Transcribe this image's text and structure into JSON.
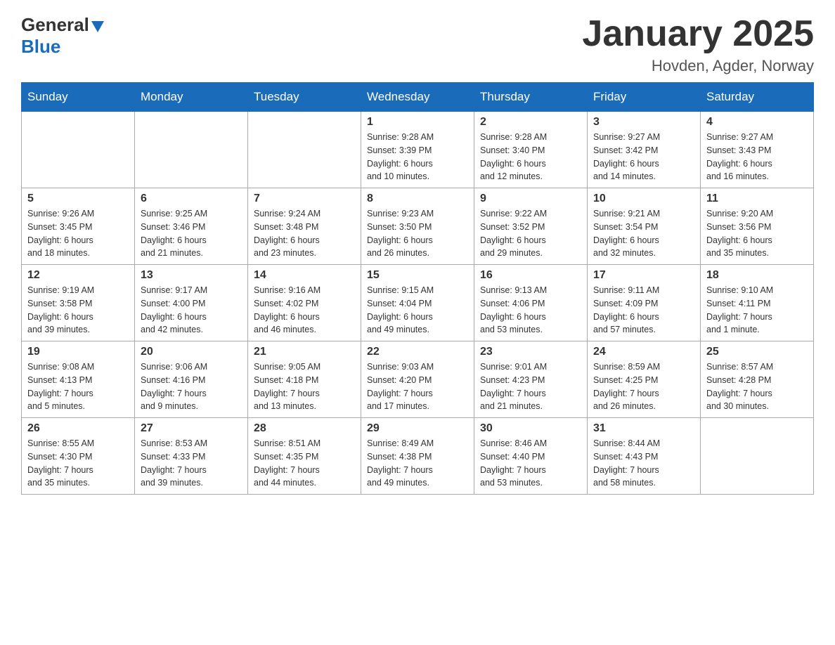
{
  "header": {
    "logo_general": "General",
    "logo_blue": "Blue",
    "month_title": "January 2025",
    "location": "Hovden, Agder, Norway"
  },
  "weekdays": [
    "Sunday",
    "Monday",
    "Tuesday",
    "Wednesday",
    "Thursday",
    "Friday",
    "Saturday"
  ],
  "weeks": [
    [
      {
        "day": "",
        "info": ""
      },
      {
        "day": "",
        "info": ""
      },
      {
        "day": "",
        "info": ""
      },
      {
        "day": "1",
        "info": "Sunrise: 9:28 AM\nSunset: 3:39 PM\nDaylight: 6 hours\nand 10 minutes."
      },
      {
        "day": "2",
        "info": "Sunrise: 9:28 AM\nSunset: 3:40 PM\nDaylight: 6 hours\nand 12 minutes."
      },
      {
        "day": "3",
        "info": "Sunrise: 9:27 AM\nSunset: 3:42 PM\nDaylight: 6 hours\nand 14 minutes."
      },
      {
        "day": "4",
        "info": "Sunrise: 9:27 AM\nSunset: 3:43 PM\nDaylight: 6 hours\nand 16 minutes."
      }
    ],
    [
      {
        "day": "5",
        "info": "Sunrise: 9:26 AM\nSunset: 3:45 PM\nDaylight: 6 hours\nand 18 minutes."
      },
      {
        "day": "6",
        "info": "Sunrise: 9:25 AM\nSunset: 3:46 PM\nDaylight: 6 hours\nand 21 minutes."
      },
      {
        "day": "7",
        "info": "Sunrise: 9:24 AM\nSunset: 3:48 PM\nDaylight: 6 hours\nand 23 minutes."
      },
      {
        "day": "8",
        "info": "Sunrise: 9:23 AM\nSunset: 3:50 PM\nDaylight: 6 hours\nand 26 minutes."
      },
      {
        "day": "9",
        "info": "Sunrise: 9:22 AM\nSunset: 3:52 PM\nDaylight: 6 hours\nand 29 minutes."
      },
      {
        "day": "10",
        "info": "Sunrise: 9:21 AM\nSunset: 3:54 PM\nDaylight: 6 hours\nand 32 minutes."
      },
      {
        "day": "11",
        "info": "Sunrise: 9:20 AM\nSunset: 3:56 PM\nDaylight: 6 hours\nand 35 minutes."
      }
    ],
    [
      {
        "day": "12",
        "info": "Sunrise: 9:19 AM\nSunset: 3:58 PM\nDaylight: 6 hours\nand 39 minutes."
      },
      {
        "day": "13",
        "info": "Sunrise: 9:17 AM\nSunset: 4:00 PM\nDaylight: 6 hours\nand 42 minutes."
      },
      {
        "day": "14",
        "info": "Sunrise: 9:16 AM\nSunset: 4:02 PM\nDaylight: 6 hours\nand 46 minutes."
      },
      {
        "day": "15",
        "info": "Sunrise: 9:15 AM\nSunset: 4:04 PM\nDaylight: 6 hours\nand 49 minutes."
      },
      {
        "day": "16",
        "info": "Sunrise: 9:13 AM\nSunset: 4:06 PM\nDaylight: 6 hours\nand 53 minutes."
      },
      {
        "day": "17",
        "info": "Sunrise: 9:11 AM\nSunset: 4:09 PM\nDaylight: 6 hours\nand 57 minutes."
      },
      {
        "day": "18",
        "info": "Sunrise: 9:10 AM\nSunset: 4:11 PM\nDaylight: 7 hours\nand 1 minute."
      }
    ],
    [
      {
        "day": "19",
        "info": "Sunrise: 9:08 AM\nSunset: 4:13 PM\nDaylight: 7 hours\nand 5 minutes."
      },
      {
        "day": "20",
        "info": "Sunrise: 9:06 AM\nSunset: 4:16 PM\nDaylight: 7 hours\nand 9 minutes."
      },
      {
        "day": "21",
        "info": "Sunrise: 9:05 AM\nSunset: 4:18 PM\nDaylight: 7 hours\nand 13 minutes."
      },
      {
        "day": "22",
        "info": "Sunrise: 9:03 AM\nSunset: 4:20 PM\nDaylight: 7 hours\nand 17 minutes."
      },
      {
        "day": "23",
        "info": "Sunrise: 9:01 AM\nSunset: 4:23 PM\nDaylight: 7 hours\nand 21 minutes."
      },
      {
        "day": "24",
        "info": "Sunrise: 8:59 AM\nSunset: 4:25 PM\nDaylight: 7 hours\nand 26 minutes."
      },
      {
        "day": "25",
        "info": "Sunrise: 8:57 AM\nSunset: 4:28 PM\nDaylight: 7 hours\nand 30 minutes."
      }
    ],
    [
      {
        "day": "26",
        "info": "Sunrise: 8:55 AM\nSunset: 4:30 PM\nDaylight: 7 hours\nand 35 minutes."
      },
      {
        "day": "27",
        "info": "Sunrise: 8:53 AM\nSunset: 4:33 PM\nDaylight: 7 hours\nand 39 minutes."
      },
      {
        "day": "28",
        "info": "Sunrise: 8:51 AM\nSunset: 4:35 PM\nDaylight: 7 hours\nand 44 minutes."
      },
      {
        "day": "29",
        "info": "Sunrise: 8:49 AM\nSunset: 4:38 PM\nDaylight: 7 hours\nand 49 minutes."
      },
      {
        "day": "30",
        "info": "Sunrise: 8:46 AM\nSunset: 4:40 PM\nDaylight: 7 hours\nand 53 minutes."
      },
      {
        "day": "31",
        "info": "Sunrise: 8:44 AM\nSunset: 4:43 PM\nDaylight: 7 hours\nand 58 minutes."
      },
      {
        "day": "",
        "info": ""
      }
    ]
  ]
}
